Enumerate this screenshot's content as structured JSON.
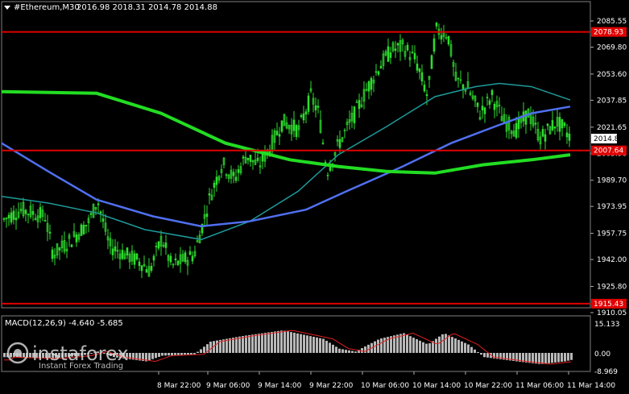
{
  "header": {
    "symbol_info": "#Ethereum,M30",
    "ohlc": "2016.98 2018.31 2014.78 2014.88"
  },
  "price_axis": {
    "ticks": [
      "2085.55",
      "2069.80",
      "2053.60",
      "2037.85",
      "2021.65",
      "2005.90",
      "1989.70",
      "1973.95",
      "1957.75",
      "1942.00",
      "1925.80",
      "1910.05"
    ],
    "current_price": "2014.88"
  },
  "levels": [
    {
      "label": "2078.93",
      "value": 2078.93
    },
    {
      "label": "2007.64",
      "value": 2007.64
    },
    {
      "label": "1915.43",
      "value": 1915.43
    }
  ],
  "macd": {
    "title": "MACD(12,26,9) -4.640 -5.685",
    "ticks": [
      "15.133",
      "0.00",
      "-8.969"
    ]
  },
  "time_axis": {
    "labels": [
      "8 Mar 22:00",
      "9 Mar 06:00",
      "9 Mar 14:00",
      "9 Mar 22:00",
      "10 Mar 06:00",
      "10 Mar 14:00",
      "10 Mar 22:00",
      "11 Mar 06:00",
      "11 Mar 14:00"
    ]
  },
  "watermark": {
    "brand": "instaforex",
    "tagline": "Instant Forex Trading"
  },
  "colors": {
    "candles": "#2fdc2f",
    "level_line": "#e00000",
    "ma_fast": "#5070f0",
    "ma_mid": "#1f9a9a",
    "ma_slow": "#22dd22",
    "macd_hist": "#b8b8b8",
    "macd_signal": "#e02020",
    "current_tag_bg": "#ffffff"
  },
  "icons": {
    "dropdown": "triangle-down-icon"
  }
}
